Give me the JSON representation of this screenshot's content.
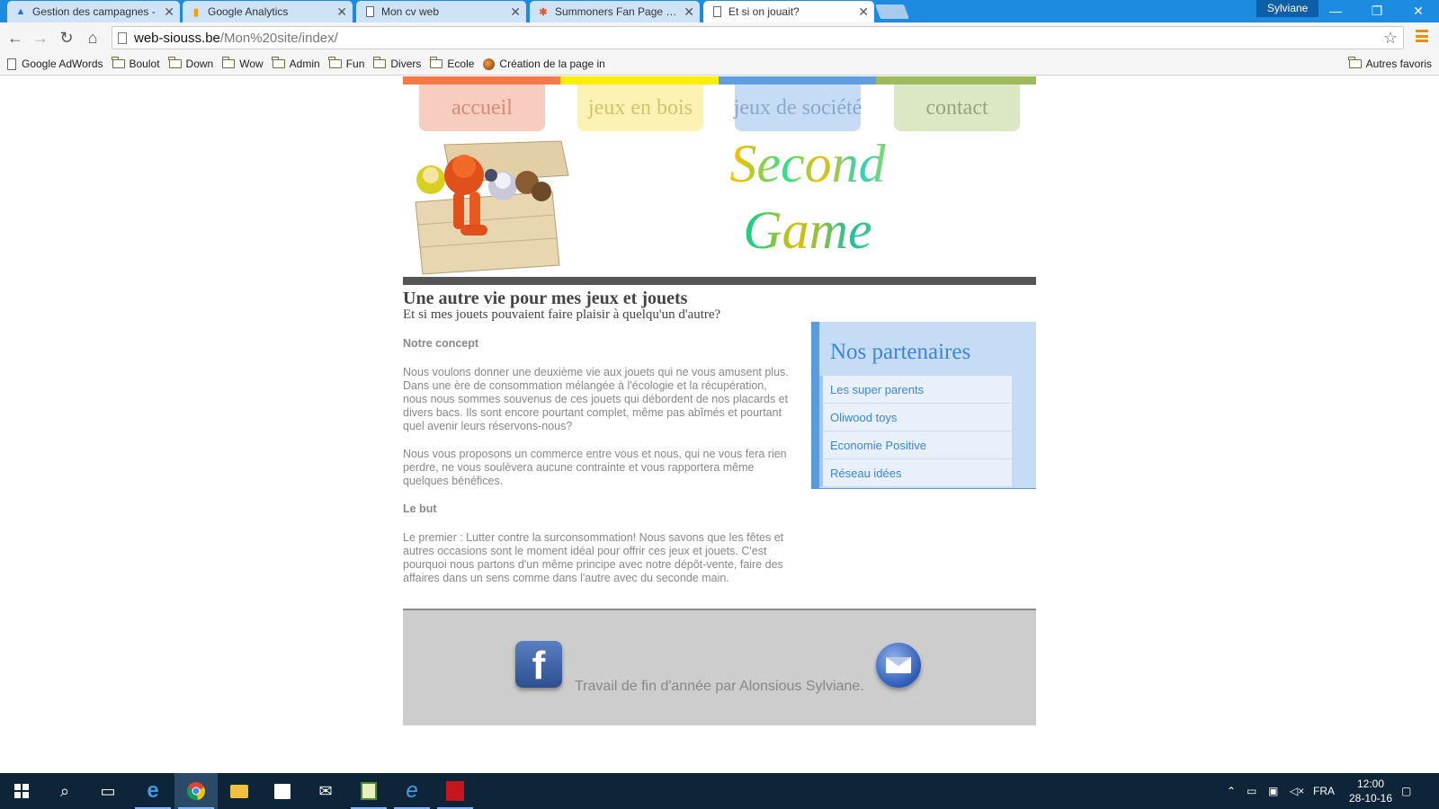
{
  "browser": {
    "tabs": [
      {
        "title": "Gestion des campagnes -",
        "favicon": "adwords-icon",
        "active": false
      },
      {
        "title": "Google Analytics",
        "favicon": "analytics-icon",
        "active": false
      },
      {
        "title": "Mon cv web",
        "favicon": "page-icon",
        "active": false
      },
      {
        "title": "Summoners Fan Page - Hu",
        "favicon": "joomla-icon",
        "active": false
      },
      {
        "title": "Et si on jouait?",
        "favicon": "page-icon",
        "active": true
      }
    ],
    "tab_close": "✕",
    "profile_name": "Sylviane",
    "url_host": "web-siouss.be",
    "url_path": "/Mon%20site/index/",
    "bookmarks": [
      "Google AdWords",
      "Boulot",
      "Down",
      "Wow",
      "Admin",
      "Fun",
      "Divers",
      "Ecole",
      "Création de la page in"
    ],
    "other_bookmarks": "Autres favoris"
  },
  "site": {
    "nav": [
      {
        "label": "accueil",
        "bar_color": "#f47a4a",
        "bg": "#f6cdbf",
        "color": "#d98d74"
      },
      {
        "label": "jeux en bois",
        "bar_color": "#ffee00",
        "bg": "#fbf2b4",
        "color": "#d2c36c"
      },
      {
        "label": "jeux de société",
        "bar_color": "#5f9ee0",
        "bg": "#c6dcf5",
        "color": "#8aa8cc"
      },
      {
        "label": "contact",
        "bar_color": "#9dbb5a",
        "bg": "#dce7c3",
        "color": "#9aa47c"
      }
    ],
    "brand_line1": "Second",
    "brand_line2": "Game",
    "title": "Une autre vie pour mes jeux et jouets",
    "subtitle": "Et si mes jouets pouvaient faire plaisir à quelqu'un d'autre?",
    "concept_heading": "Notre concept",
    "concept_p1": "Nous voulons donner une deuxième vie aux jouets qui ne vous amusent plus. Dans une ère de consommation mélangée à l'écologie et la récupération, nous nous sommes souvenus de ces jouets qui débordent de nos placards et divers bacs. Ils sont encore pourtant complet, même pas abîmés et pourtant quel avenir leurs réservons-nous?",
    "concept_p2": "Nous vous proposons un commerce entre vous et nous, qui ne vous fera rien perdre, ne vous soulèvera aucune contrainte et vous rapportera même quelques bénéfices.",
    "goal_heading": "Le but",
    "goal_p1": "Le premier : Lutter contre la surconsommation! Nous savons que les fêtes et autres occasions sont le moment idéal pour offrir ces jeux et jouets. C'est pourquoi nous partons d'un même principe avec notre dépôt-vente, faire des affaires dans un sens comme dans l'autre avec du seconde main.",
    "partners_title": "Nos partenaires",
    "partners": [
      "Les super parents",
      "Oliwood toys",
      "Economie Positive",
      "Réseau idées"
    ],
    "footer_text": "Travail de fin d'année par Alonsious Sylviane."
  },
  "taskbar": {
    "language": "FRA",
    "time": "12:00",
    "date": "28-10-16"
  }
}
